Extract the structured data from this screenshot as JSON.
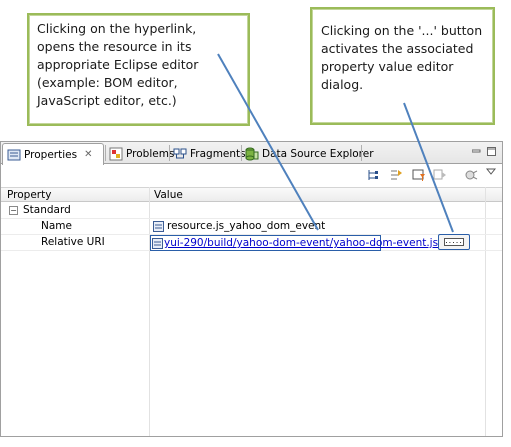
{
  "callouts": {
    "left": [
      "Clicking on the hyperlink,",
      "opens the resource in its",
      "appropriate Eclipse editor",
      "(example: BOM editor,",
      "JavaScript editor, etc.)"
    ],
    "right": [
      "Clicking on the '...'  button",
      "activates the associated",
      "property value editor",
      "dialog."
    ]
  },
  "tabs": [
    {
      "label": "Properties",
      "icon": "properties-icon",
      "close": "✕"
    },
    {
      "label": "Problems",
      "icon": "problems-icon"
    },
    {
      "label": "Fragments",
      "icon": "fragments-icon"
    },
    {
      "label": "Data Source Explorer",
      "icon": "data-source-explorer-icon"
    }
  ],
  "window_controls": [
    "minimize-icon",
    "maximize-icon"
  ],
  "toolbar_icons": [
    "show-categories-icon",
    "show-advanced-icon",
    "filter-icon",
    "restore-default-icon",
    "pin-icon",
    "view-menu-icon"
  ],
  "grid": {
    "columns": [
      "Property",
      "Value"
    ],
    "group": {
      "toggle": "−",
      "label": "Standard"
    },
    "rows": [
      {
        "property": "Name",
        "value": "resource.js_yahoo_dom_event"
      },
      {
        "property": "Relative URI",
        "value": "yui-290/build/yahoo-dom-event/yahoo-dom-event.js",
        "button": "....."
      }
    ]
  },
  "colors": {
    "callout_border": "#9bbb59",
    "arrow": "#4f81bd",
    "link": "#0000cc",
    "focus": "#2a5ea8"
  }
}
